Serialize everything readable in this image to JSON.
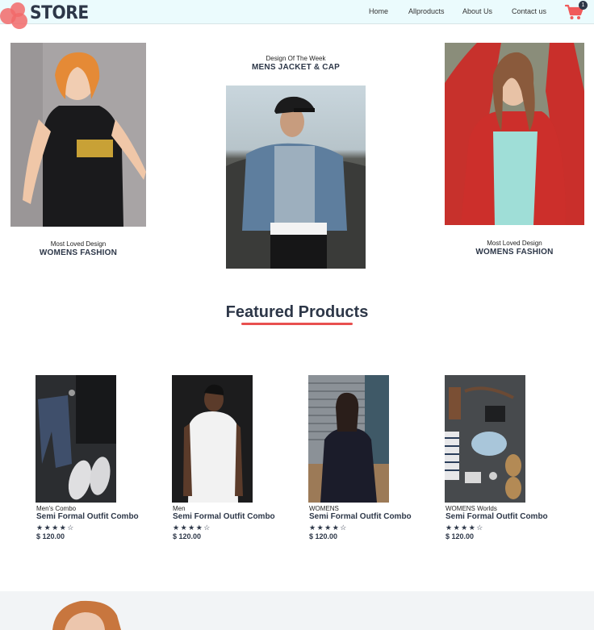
{
  "header": {
    "logo_text": "STORE",
    "nav": [
      {
        "label": "Home"
      },
      {
        "label": "Allproducts"
      },
      {
        "label": "About Us"
      },
      {
        "label": "Contact us"
      }
    ],
    "cart_count": "1"
  },
  "hero": {
    "left": {
      "subtitle": "Most Loved Design",
      "title": "WOMENS FASHION"
    },
    "center": {
      "subtitle": "Design Of The Week",
      "title": "MENS JACKET & CAP"
    },
    "right": {
      "subtitle": "Most Loved Design",
      "title": "WOMENS FASHION"
    }
  },
  "featured": {
    "title": "Featured Products",
    "products": [
      {
        "category": "Men's Combo",
        "name": "Semi Formal Outfit Combo",
        "stars": "★★★★☆",
        "price": "$ 120.00"
      },
      {
        "category": "Men",
        "name": "Semi Formal Outfit Combo",
        "stars": "★★★★☆",
        "price": "$ 120.00"
      },
      {
        "category": "WOMENS",
        "name": "Semi Formal Outfit Combo",
        "stars": "★★★★☆",
        "price": "$ 120.00"
      },
      {
        "category": "WOMENS Worlds",
        "name": "Semi Formal Outfit Combo",
        "stars": "★★★★☆",
        "price": "$ 120.00"
      }
    ]
  },
  "colors": {
    "header_bg": "#ebfbfd",
    "accent": "#e8504f",
    "text_dark": "#2d3748"
  }
}
